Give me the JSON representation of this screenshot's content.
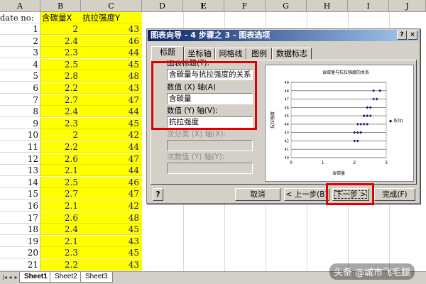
{
  "spreadsheet": {
    "columns": [
      "A",
      "B",
      "C",
      "D",
      "E",
      "F",
      "G",
      "H",
      "I",
      "J"
    ],
    "a1": "date no:",
    "b1": "含碳量X",
    "c1": "抗拉强度Y",
    "rows": [
      {
        "n": "1",
        "x": "2",
        "y": "43"
      },
      {
        "n": "2",
        "x": "2.4",
        "y": "46"
      },
      {
        "n": "3",
        "x": "2.3",
        "y": "44"
      },
      {
        "n": "4",
        "x": "2.5",
        "y": "45"
      },
      {
        "n": "5",
        "x": "2.8",
        "y": "48"
      },
      {
        "n": "6",
        "x": "2.2",
        "y": "43"
      },
      {
        "n": "7",
        "x": "2.7",
        "y": "47"
      },
      {
        "n": "8",
        "x": "2.4",
        "y": "44"
      },
      {
        "n": "9",
        "x": "2.3",
        "y": "45"
      },
      {
        "n": "10",
        "x": "2",
        "y": "42"
      },
      {
        "n": "11",
        "x": "2.2",
        "y": "44"
      },
      {
        "n": "12",
        "x": "2.6",
        "y": "47"
      },
      {
        "n": "13",
        "x": "2.1",
        "y": "44"
      },
      {
        "n": "14",
        "x": "2.5",
        "y": "46"
      },
      {
        "n": "15",
        "x": "2.7",
        "y": "47"
      },
      {
        "n": "16",
        "x": "2.1",
        "y": "42"
      },
      {
        "n": "17",
        "x": "2.6",
        "y": "48"
      },
      {
        "n": "18",
        "x": "2.4",
        "y": "45"
      },
      {
        "n": "19",
        "x": "2.1",
        "y": "43"
      },
      {
        "n": "20",
        "x": "2.3",
        "y": "45"
      },
      {
        "n": "21",
        "x": "2.2",
        "y": "43"
      }
    ],
    "sheet_tabs": [
      "Sheet1",
      "Sheet2",
      "Sheet3"
    ]
  },
  "dialog": {
    "title": "图表向导 - 4 步骤之 3 - 图表选项",
    "help_btn": "?",
    "close_btn": "×",
    "tabs": [
      "标题",
      "坐标轴",
      "网格线",
      "图例",
      "数据标志"
    ],
    "chart_title_label": "图表标题(T):",
    "chart_title_value": "含碳量与抗拉强度的关系",
    "x_axis_label": "数值 (X) 轴(A)",
    "x_axis_value": "含碳量",
    "y_axis_label": "数值 (Y) 轴(V):",
    "y_axis_value": "抗拉强度",
    "x2_label": "次分类 (X) 轴(X):",
    "y2_label": "次数值 (Y) 轴(Y):",
    "buttons": {
      "help": "?",
      "cancel": "取消",
      "back": "< 上一步(B)",
      "next": "下一步 >",
      "finish": "完成(F)"
    }
  },
  "preview": {
    "title": "含碳量与抗拉强度的关系",
    "ylabel": "抗拉强度",
    "xlabel": "含碳量",
    "legend": "◆ 系列1"
  },
  "chart_data": {
    "type": "scatter",
    "title": "含碳量与抗拉强度的关系",
    "xlabel": "含碳量",
    "ylabel": "抗拉强度",
    "xlim": [
      0,
      3
    ],
    "ylim": [
      40,
      49
    ],
    "x_ticks": [
      "0",
      "1",
      "2",
      "3"
    ],
    "y_ticks": [
      "40",
      "41",
      "42",
      "43",
      "44",
      "45",
      "46",
      "47",
      "48",
      "49"
    ],
    "series": [
      {
        "name": "系列1",
        "color": "#1a1a8a",
        "points": [
          [
            2,
            43
          ],
          [
            2.4,
            46
          ],
          [
            2.3,
            44
          ],
          [
            2.5,
            45
          ],
          [
            2.8,
            48
          ],
          [
            2.2,
            43
          ],
          [
            2.7,
            47
          ],
          [
            2.4,
            44
          ],
          [
            2.3,
            45
          ],
          [
            2,
            42
          ],
          [
            2.2,
            44
          ],
          [
            2.6,
            47
          ],
          [
            2.1,
            44
          ],
          [
            2.5,
            46
          ],
          [
            2.7,
            47
          ],
          [
            2.1,
            42
          ],
          [
            2.6,
            48
          ],
          [
            2.4,
            45
          ],
          [
            2.1,
            43
          ],
          [
            2.3,
            45
          ],
          [
            2.2,
            43
          ]
        ]
      }
    ]
  },
  "watermark": "头条 @城市飞毛腿",
  "colors": {
    "highlight": "#ffff00",
    "red_box": "#e00000",
    "title_bar": "#0a246a",
    "point": "#1a1a8a"
  }
}
